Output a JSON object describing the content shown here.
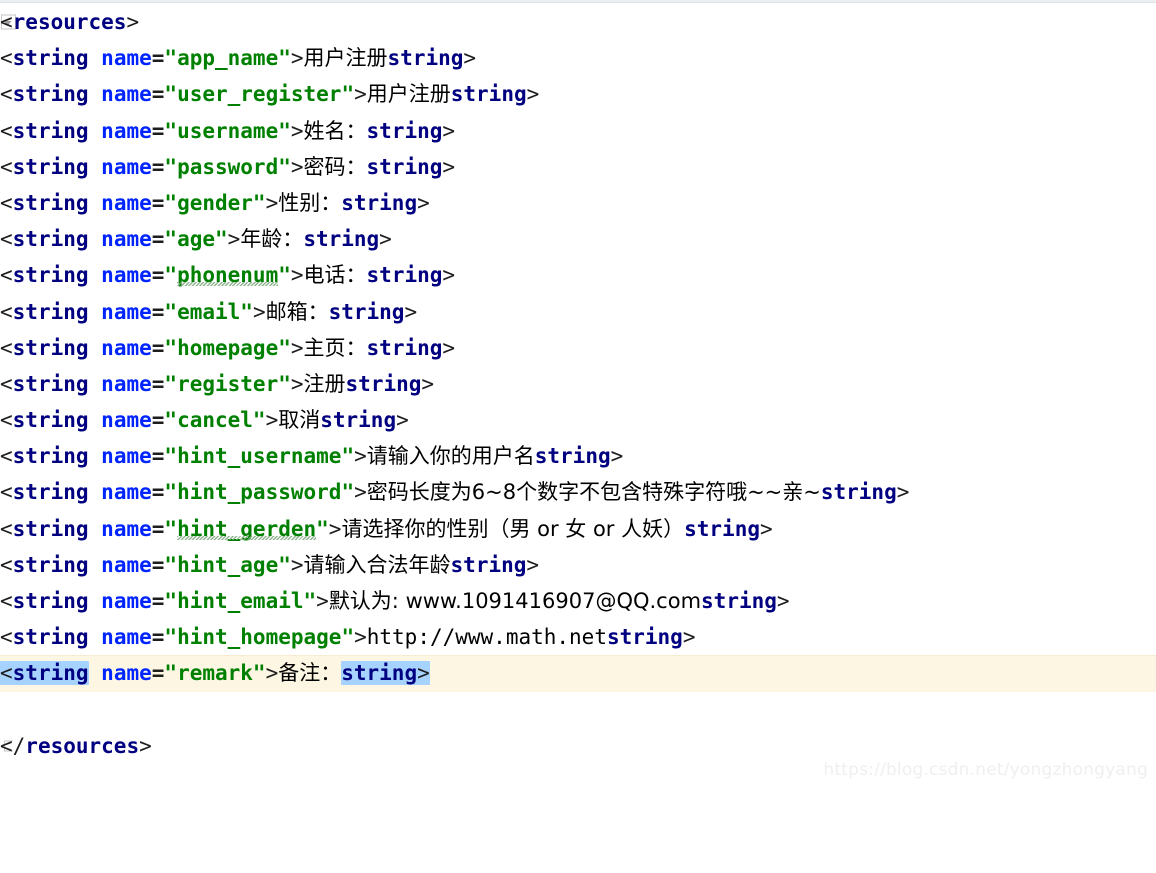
{
  "editor": {
    "file_type": "xml",
    "language": "Android string resources",
    "colors": {
      "background": "#ffffff",
      "tag_name": "#000080",
      "attribute": "#0024ff",
      "attribute_value": "#008000",
      "text_content": "#000000",
      "bracket": "#1d1d1d",
      "current_line_highlight": "#fdf6e3",
      "selection": "#a6d2ff",
      "typo_squiggle": "#7da87d",
      "watermark": "#efefef"
    }
  },
  "gutter": {
    "fold_open_icon": "fold-expanded-icon",
    "fold_end_icon": "fold-end-icon",
    "intention_icon": "lightbulb-icon"
  },
  "code": {
    "open_tag": "<resources>",
    "close_tag": "</resources>",
    "tag": "string",
    "attr_name": "name",
    "open_bracket": "<",
    "close_bracket": ">",
    "end_open": "</",
    "quote": "\"",
    "equals": "=",
    "lines": [
      {
        "key": "app_name",
        "value": "用户注册",
        "typo": false
      },
      {
        "key": "user_register",
        "value": "用户注册",
        "typo": false
      },
      {
        "key": "username",
        "value": "姓名：",
        "typo": false
      },
      {
        "key": "password",
        "value": "密码：",
        "typo": false
      },
      {
        "key": "gender",
        "value": "性别：",
        "typo": false
      },
      {
        "key": "age",
        "value": "年龄：",
        "typo": false
      },
      {
        "key": "phonenum",
        "value": "电话：",
        "typo": true
      },
      {
        "key": "email",
        "value": "邮箱：",
        "typo": false
      },
      {
        "key": "homepage",
        "value": "主页：",
        "typo": false
      },
      {
        "key": "register",
        "value": "注册",
        "typo": false
      },
      {
        "key": "cancel",
        "value": "取消",
        "typo": false
      },
      {
        "key": "hint_username",
        "value": "请输入你的用户名",
        "typo": false
      },
      {
        "key": "hint_password",
        "value": "密码长度为6~8个数字不包含特殊字符哦~~亲~",
        "typo": false
      },
      {
        "key": "hint_gerden",
        "value": "请选择你的性别（男 or 女 or 人妖）",
        "typo": true
      },
      {
        "key": "hint_age",
        "value": "请输入合法年龄",
        "typo": false
      },
      {
        "key": "hint_email",
        "value": "默认为: www.1091416907@QQ.com",
        "typo": false
      },
      {
        "key": "hint_homepage",
        "value": "http://www.math.net",
        "typo": false
      },
      {
        "key": "remark",
        "value": "备注：",
        "typo": false
      }
    ],
    "current_line_index": 17
  },
  "watermark": {
    "text": "https://blog.csdn.net/yongzhongyang"
  }
}
